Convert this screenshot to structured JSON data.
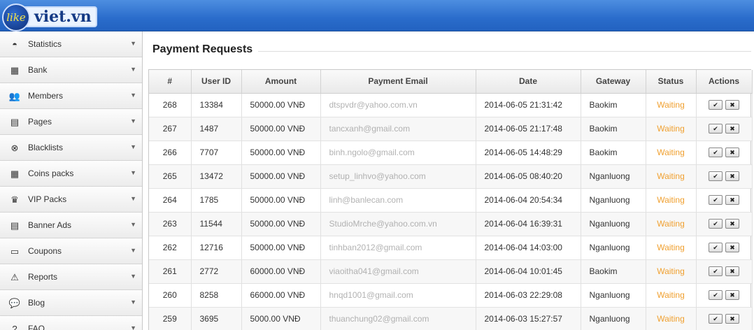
{
  "brand": {
    "logo_like": "like",
    "logo_text": "viet.vn"
  },
  "sidebar": {
    "items": [
      {
        "label": "Statistics",
        "icon": "dashboard-icon",
        "glyph": "◓"
      },
      {
        "label": "Bank",
        "icon": "bank-icon",
        "glyph": "▦"
      },
      {
        "label": "Members",
        "icon": "members-icon",
        "glyph": "👥"
      },
      {
        "label": "Pages",
        "icon": "pages-icon",
        "glyph": "▤"
      },
      {
        "label": "Blacklists",
        "icon": "blacklist-icon",
        "glyph": "⊗"
      },
      {
        "label": "Coins packs",
        "icon": "coins-icon",
        "glyph": "▦"
      },
      {
        "label": "VIP Packs",
        "icon": "vip-icon",
        "glyph": "♛"
      },
      {
        "label": "Banner Ads",
        "icon": "banner-icon",
        "glyph": "▤"
      },
      {
        "label": "Coupons",
        "icon": "coupons-icon",
        "glyph": "▭"
      },
      {
        "label": "Reports",
        "icon": "warning-icon",
        "glyph": "⚠"
      },
      {
        "label": "Blog",
        "icon": "blog-icon",
        "glyph": "💬"
      },
      {
        "label": "FAQ",
        "icon": "faq-icon",
        "glyph": "?"
      }
    ]
  },
  "main": {
    "title": "Payment Requests",
    "columns": [
      "#",
      "User ID",
      "Amount",
      "Payment Email",
      "Date",
      "Gateway",
      "Status",
      "Actions"
    ],
    "rows": [
      {
        "id": "268",
        "user": "13384",
        "amount": "50000.00 VNĐ",
        "email": "dtspvdr@yahoo.com.vn",
        "date": "2014-06-05 21:31:42",
        "gateway": "Baokim",
        "status": "Waiting"
      },
      {
        "id": "267",
        "user": "1487",
        "amount": "50000.00 VNĐ",
        "email": "tancxanh@gmail.com",
        "date": "2014-06-05 21:17:48",
        "gateway": "Baokim",
        "status": "Waiting"
      },
      {
        "id": "266",
        "user": "7707",
        "amount": "50000.00 VNĐ",
        "email": "binh.ngolo@gmail.com",
        "date": "2014-06-05 14:48:29",
        "gateway": "Baokim",
        "status": "Waiting"
      },
      {
        "id": "265",
        "user": "13472",
        "amount": "50000.00 VNĐ",
        "email": "setup_linhvo@yahoo.com",
        "date": "2014-06-05 08:40:20",
        "gateway": "Nganluong",
        "status": "Waiting"
      },
      {
        "id": "264",
        "user": "1785",
        "amount": "50000.00 VNĐ",
        "email": "linh@banlecan.com",
        "date": "2014-06-04 20:54:34",
        "gateway": "Nganluong",
        "status": "Waiting"
      },
      {
        "id": "263",
        "user": "11544",
        "amount": "50000.00 VNĐ",
        "email": "StudioMrche@yahoo.com.vn",
        "date": "2014-06-04 16:39:31",
        "gateway": "Nganluong",
        "status": "Waiting"
      },
      {
        "id": "262",
        "user": "12716",
        "amount": "50000.00 VNĐ",
        "email": "tinhban2012@gmail.com",
        "date": "2014-06-04 14:03:00",
        "gateway": "Nganluong",
        "status": "Waiting"
      },
      {
        "id": "261",
        "user": "2772",
        "amount": "60000.00 VNĐ",
        "email": "viaoitha041@gmail.com",
        "date": "2014-06-04 10:01:45",
        "gateway": "Baokim",
        "status": "Waiting"
      },
      {
        "id": "260",
        "user": "8258",
        "amount": "66000.00 VNĐ",
        "email": "hnqd1001@gmail.com",
        "date": "2014-06-03 22:29:08",
        "gateway": "Nganluong",
        "status": "Waiting"
      },
      {
        "id": "259",
        "user": "3695",
        "amount": "5000.00 VNĐ",
        "email": "thuanchung02@gmail.com",
        "date": "2014-06-03 15:27:57",
        "gateway": "Nganluong",
        "status": "Waiting"
      }
    ],
    "actions": {
      "approve_glyph": "✔",
      "reject_glyph": "✖"
    }
  },
  "colors": {
    "status_waiting": "#f0a030",
    "header_blue": "#2a6ccb"
  }
}
